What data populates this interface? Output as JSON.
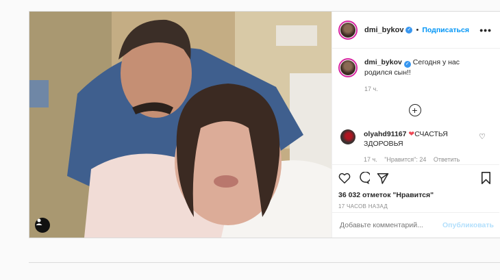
{
  "post": {
    "username": "dmi_bykov",
    "verified_icon": "verified-badge-icon",
    "dot": "•",
    "follow_label": "Подписаться",
    "more_label": "•••",
    "caption": "Сегодня у нас родился сын!!",
    "caption_time": "17 ч.",
    "load_more_label": "+",
    "comment": {
      "username": "olyahd91167",
      "heart": "❤",
      "text": "СЧАСТЬЯ ЗДОРОВЬЯ",
      "time": "17 ч.",
      "likes": "\"Нравится\": 24",
      "reply": "Ответить"
    },
    "likes_text": "36 032 отметок \"Нравится\"",
    "posted_ago": "17 ЧАСОВ НАЗАД",
    "comment_placeholder": "Добавьте комментарий...",
    "publish_label": "Опубликовать"
  },
  "colors": {
    "accent": "#0095f6",
    "publish_disabled": "#b2dffc",
    "border": "#dbdbdb",
    "heart": "#ed4956"
  }
}
